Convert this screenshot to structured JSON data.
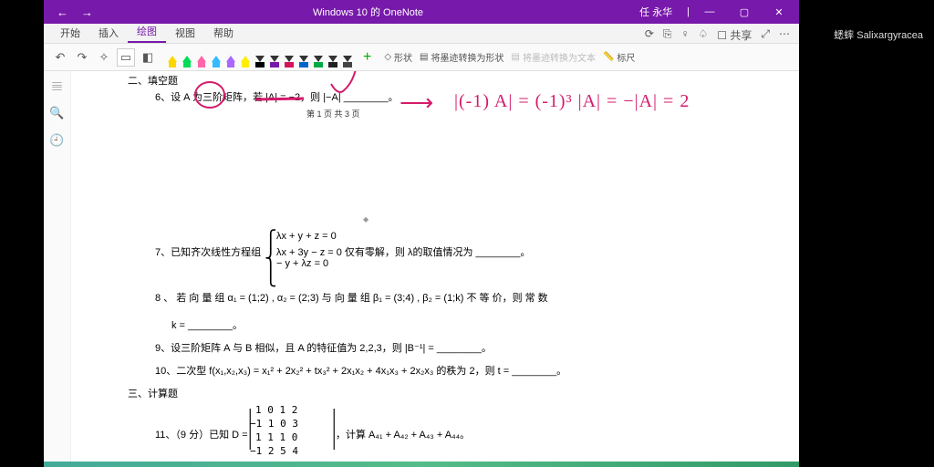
{
  "titlebar": {
    "title": "Windows 10 的 OneNote",
    "user": "任 永华"
  },
  "tabs": {
    "items": [
      "开始",
      "插入",
      "绘图",
      "视图",
      "帮助"
    ],
    "active": 2
  },
  "ribbon": {
    "plus": "+",
    "shape": "形状",
    "ink_to_shape": "将墨迹转换为形状",
    "ink_to_text": "将墨迹转换为文本",
    "ruler": "标尺",
    "share": "共享"
  },
  "pens": [
    {
      "type": "hl",
      "color": "#ffd700"
    },
    {
      "type": "hl",
      "color": "#00dd55"
    },
    {
      "type": "hl",
      "color": "#ff66aa"
    },
    {
      "type": "hl",
      "color": "#33bbff"
    },
    {
      "type": "hl",
      "color": "#aa66ff"
    },
    {
      "type": "hl",
      "color": "#ffee00"
    },
    {
      "type": "mk",
      "color": "#000"
    },
    {
      "type": "mk",
      "color": "#7719aa"
    },
    {
      "type": "mk",
      "color": "#d4145a"
    },
    {
      "type": "mk",
      "color": "#0066cc"
    },
    {
      "type": "mk",
      "color": "#00aa44"
    },
    {
      "type": "mk",
      "color": "#222"
    },
    {
      "type": "mk",
      "color": "#444"
    }
  ],
  "doc": {
    "sec_fill": "二、填空题",
    "q6": "6、设 A 为三阶矩阵，若 |A| = −2，则 |−A| ________。",
    "page_foot": "第 1 页   共 3 页",
    "q7a": "7、已知齐次线性方程组",
    "q7sys1": "λx + y + z = 0",
    "q7sys2": "λx + 3y − z = 0 仅有零解，则 λ的取值情况为 ________。",
    "q7sys3": "− y + λz = 0",
    "q8": "8 、 若 向 量 组 α₁ = (1;2) , α₂ = (2;3) 与 向 量 组 β₁ = (3;4) , β₂ = (1;k) 不 等 价，则 常 数",
    "q8k": "k = ________。",
    "q9": "9、设三阶矩阵 A 与 B 相似，且 A 的特征值为 2,2,3，则 |B⁻¹| = ________。",
    "q10": "10、二次型 f(x₁,x₂,x₃) = x₁² + 2x₂² + tx₃² + 2x₁x₂ + 4x₁x₃ + 2x₂x₃ 的秩为 2，则 t = ________。",
    "sec_calc": "三、计算题",
    "q11": "11、（9 分）已知 D =",
    "q11m1": "1   0   1   2",
    "q11m2": "−1  1   0   3",
    "q11m3": "1   1   1   0",
    "q11m4": "−1  2   5   4",
    "q11tail": "，计算 A₄₁ + A₄₂ + A₄₃ + A₄₄。"
  },
  "ink": {
    "arrow": "⟶",
    "eq": "|(-1) A| = (-1)³ |A| = −|A| = 2"
  },
  "watermark": "蟋蟀 Salixargyracea"
}
